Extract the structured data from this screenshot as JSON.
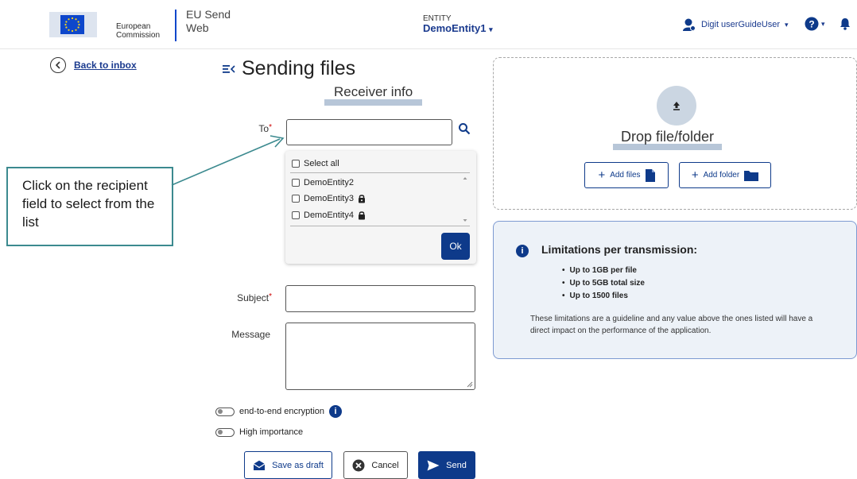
{
  "header": {
    "logo_line1": "European",
    "logo_line2": "Commission",
    "app_name_line1": "EU Send",
    "app_name_line2": "Web",
    "entity_label": "ENTITY",
    "entity_value": "DemoEntity1",
    "user_name": "Digit userGuideUser"
  },
  "nav": {
    "back_label": "Back to inbox"
  },
  "callout": {
    "text": "Click on the recipient field to select from the list"
  },
  "form": {
    "page_title": "Sending files",
    "section_title": "Receiver info",
    "to_label": "To",
    "to_value": "",
    "required_mark": "*",
    "dropdown": {
      "select_all": "Select all",
      "items": [
        "DemoEntity2",
        "DemoEntity3",
        "DemoEntity4"
      ],
      "ok_label": "Ok"
    },
    "subject_label": "Subject",
    "subject_value": "",
    "message_label": "Message",
    "message_value": "",
    "e2e_label": "end-to-end encryption",
    "importance_label": "High importance",
    "save_draft_label": "Save as draft",
    "cancel_label": "Cancel",
    "send_label": "Send"
  },
  "drop": {
    "title": "Drop file/folder",
    "add_files_label": "Add files",
    "add_folder_label": "Add folder"
  },
  "limits": {
    "title": "Limitations per transmission:",
    "items": [
      "Up to 1GB per file",
      "Up to 5GB total size",
      "Up to 1500 files"
    ],
    "note": "These limitations are a guideline and any value above the ones listed will have a direct impact on the performance of the application."
  },
  "colors": {
    "primary": "#0e3a8a",
    "accent_bar": "#b7c6d8",
    "callout_border": "#3c8a8f",
    "limits_bg": "#edf2f8"
  }
}
